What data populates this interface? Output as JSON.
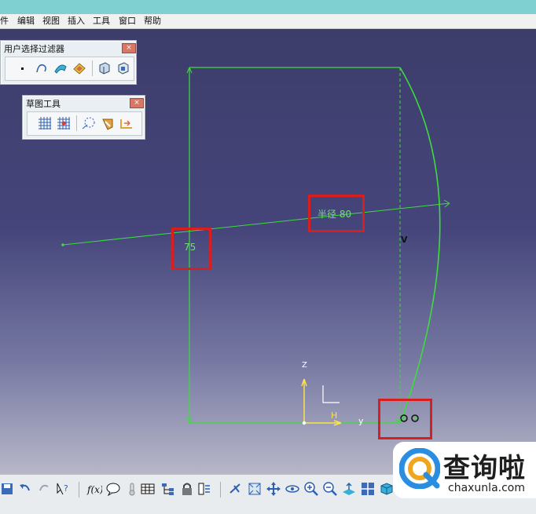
{
  "menu": {
    "items": [
      "件",
      "编辑",
      "视图",
      "插入",
      "工具",
      "窗口",
      "帮助"
    ]
  },
  "user_filter_toolbar": {
    "title": "用户选择过滤器",
    "buttons": [
      "point-filter-icon",
      "curve-filter-icon",
      "surface-filter-icon",
      "volume-filter-icon",
      "geometric-element-filter-icon",
      "feature-element-filter-icon"
    ]
  },
  "sketch_tools_toolbar": {
    "title": "草图工具",
    "buttons": [
      "grid-icon",
      "snap-to-point-icon",
      "construction-element-icon",
      "geometric-constraints-icon",
      "dimensional-constraints-icon"
    ]
  },
  "sketch": {
    "radius_label": "半径 80",
    "vertical_dim_label": "75",
    "axis_labels": {
      "z": "Z",
      "h": "H",
      "y": "y",
      "v": "V"
    },
    "line_color": "#3ddc3d"
  },
  "bottom_toolbar": {
    "buttons": [
      "save-icon",
      "undo-icon",
      "redo-icon",
      "whats-this-icon",
      "formula-icon",
      "comment-icon",
      "thermometer-icon",
      "table-icon",
      "tree-icon",
      "lock-icon",
      "param-icon",
      "fly-icon",
      "fit-all-icon",
      "pan-icon",
      "rotate-icon",
      "zoom-in-icon",
      "zoom-out-icon",
      "normal-view-icon",
      "multi-view-icon",
      "iso-view-icon",
      "box-view-icon"
    ]
  },
  "watermark": {
    "main": "查询啦",
    "sub": "chaxunla.com"
  }
}
